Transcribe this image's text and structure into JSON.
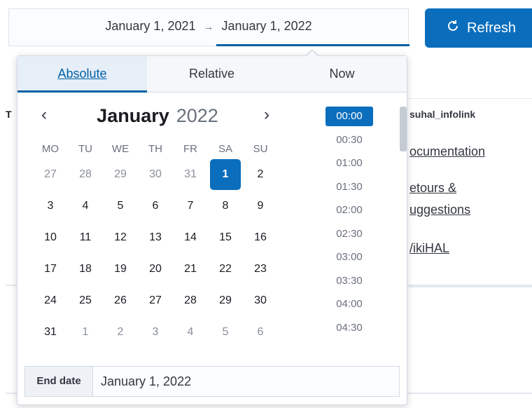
{
  "range": {
    "start": "January 1, 2021",
    "arrow": "→",
    "end": "January 1, 2022"
  },
  "refresh": {
    "label": "Refresh",
    "icon": "refresh-icon"
  },
  "background": {
    "left_letter": "T",
    "heading": "suhal_infolink",
    "links": [
      "ocumentation",
      "etours &",
      "uggestions",
      "/ikiHAL"
    ]
  },
  "picker": {
    "tabs": [
      {
        "label": "Absolute",
        "active": true
      },
      {
        "label": "Relative"
      },
      {
        "label": "Now"
      }
    ],
    "calendar": {
      "month": "January",
      "year": "2022",
      "prev_icon": "chevron-left-icon",
      "next_icon": "chevron-right-icon",
      "weekdays": [
        "MO",
        "TU",
        "WE",
        "TH",
        "FR",
        "SA",
        "SU"
      ],
      "weeks": [
        [
          "27",
          "28",
          "29",
          "30",
          "31",
          "1",
          "2"
        ],
        [
          "3",
          "4",
          "5",
          "6",
          "7",
          "8",
          "9"
        ],
        [
          "10",
          "11",
          "12",
          "13",
          "14",
          "15",
          "16"
        ],
        [
          "17",
          "18",
          "19",
          "20",
          "21",
          "22",
          "23"
        ],
        [
          "24",
          "25",
          "26",
          "27",
          "28",
          "29",
          "30"
        ],
        [
          "31",
          "1",
          "2",
          "3",
          "4",
          "5",
          "6"
        ]
      ],
      "selected_day": "1"
    },
    "times": [
      "00:00",
      "00:30",
      "01:00",
      "01:30",
      "02:00",
      "02:30",
      "03:00",
      "03:30",
      "04:00",
      "04:30"
    ],
    "selected_time": "00:00",
    "footer": {
      "label": "End date",
      "value": "January 1, 2022"
    }
  },
  "colors": {
    "accent": "#0a6ebd",
    "muted_text": "#69707d"
  }
}
